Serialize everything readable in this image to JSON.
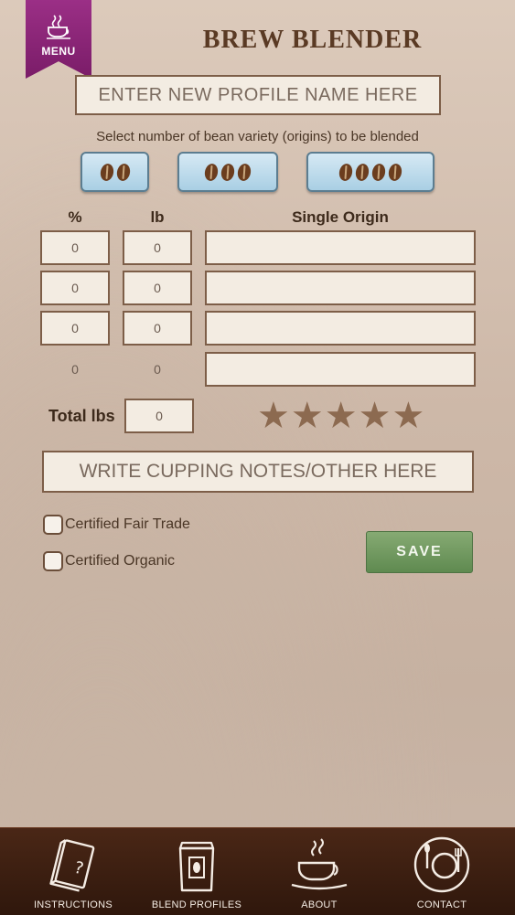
{
  "header": {
    "menu_label": "MENU",
    "title": "BREW BLENDER"
  },
  "profile": {
    "name_placeholder": "ENTER NEW PROFILE NAME HERE"
  },
  "bean_selector": {
    "instruction": "Select number of bean variety (origins) to be blended",
    "options": [
      2,
      3,
      4
    ]
  },
  "blend_table": {
    "headers": {
      "percent": "%",
      "lb": "lb",
      "origin": "Single Origin"
    },
    "rows": [
      {
        "percent": "0",
        "lb": "0",
        "origin": ""
      },
      {
        "percent": "0",
        "lb": "0",
        "origin": ""
      },
      {
        "percent": "0",
        "lb": "0",
        "origin": ""
      },
      {
        "percent": "0",
        "lb": "0",
        "origin": ""
      }
    ]
  },
  "totals": {
    "label": "Total lbs",
    "value": "0"
  },
  "rating": {
    "max": 5,
    "value": 0
  },
  "notes": {
    "placeholder": "WRITE CUPPING NOTES/OTHER HERE"
  },
  "certifications": {
    "fair_trade_label": "Certified Fair Trade",
    "fair_trade_checked": false,
    "organic_label": "Certified Organic",
    "organic_checked": false
  },
  "actions": {
    "save_label": "SAVE"
  },
  "bottom_nav": {
    "items": [
      {
        "label": "INSTRUCTIONS",
        "icon": "instructions-book-icon"
      },
      {
        "label": "BLEND PROFILES",
        "icon": "coffee-bag-icon"
      },
      {
        "label": "ABOUT",
        "icon": "coffee-cup-icon"
      },
      {
        "label": "CONTACT",
        "icon": "plate-cutlery-icon"
      }
    ]
  },
  "colors": {
    "menu_ribbon": "#8a2476",
    "save_button": "#6f9a5e",
    "bean_button": "#bcdcee",
    "bottom_bar": "#3b1d10"
  }
}
